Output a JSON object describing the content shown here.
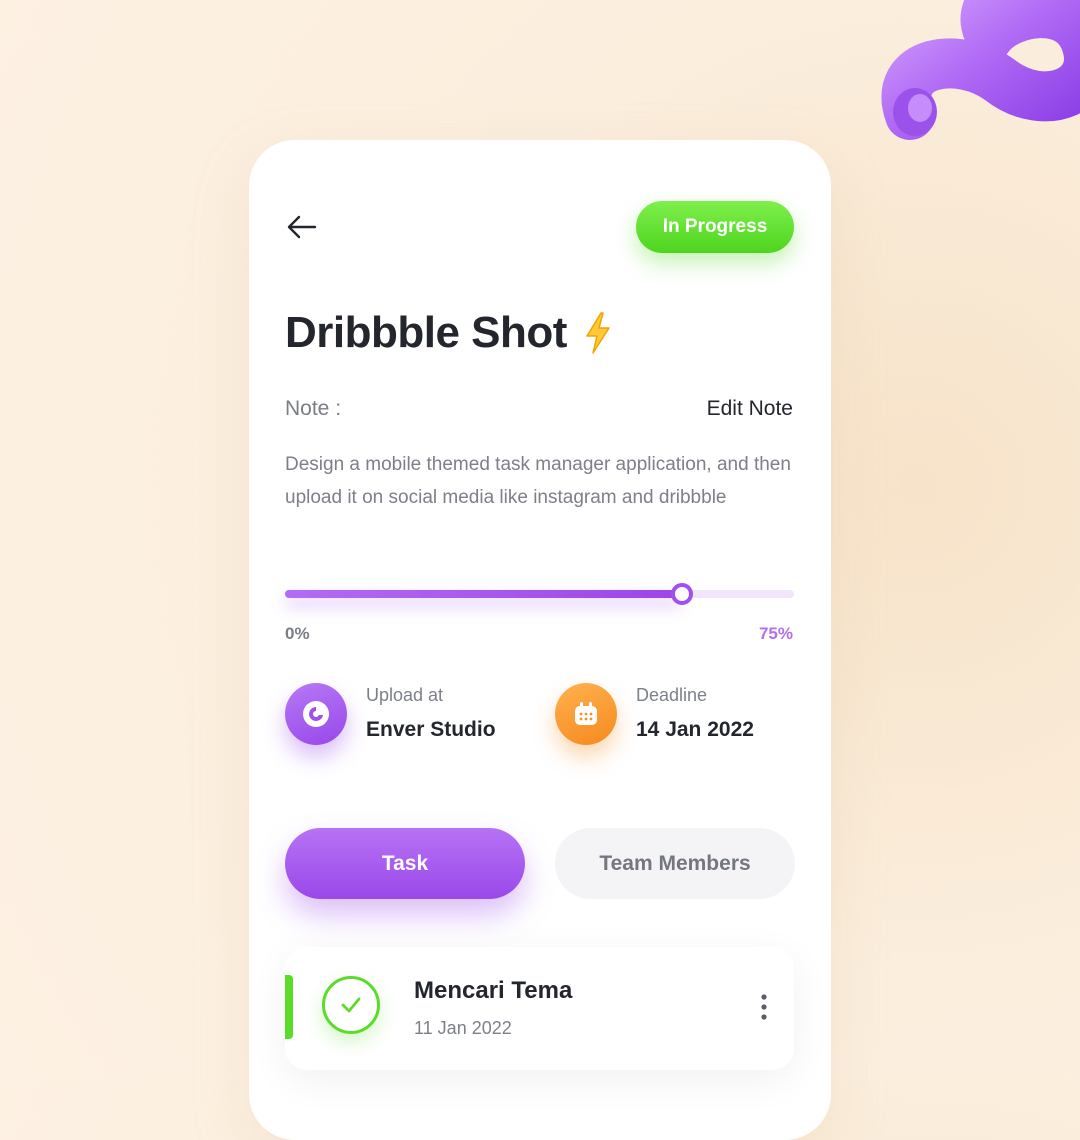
{
  "header": {
    "status_badge": "In Progress",
    "status_color": "#5cdc2a"
  },
  "project": {
    "title": "Dribbble Shot",
    "title_emoji_icon": "lightning-bolt-icon",
    "note_label": "Note :",
    "edit_note_label": "Edit Note",
    "description": "Design a mobile themed task manager application, and then upload it on social media like instagram and dribbble"
  },
  "progress": {
    "value": 0.78,
    "min_label": "0%",
    "max_label": "75%",
    "color": "#a24ff0"
  },
  "info": {
    "upload": {
      "label": "Upload at",
      "value": "Enver Studio",
      "icon": "studio-logo-icon",
      "color": "#9f50ef"
    },
    "deadline": {
      "label": "Deadline",
      "value": "14 Jan 2022",
      "icon": "calendar-icon",
      "color": "#f7921f"
    }
  },
  "tabs": [
    {
      "label": "Task",
      "active": true
    },
    {
      "label": "Team Members",
      "active": false
    }
  ],
  "tasks": [
    {
      "name": "Mencari Tema",
      "date": "11 Jan 2022",
      "done": true,
      "icon": "check-circle-icon"
    }
  ],
  "colors": {
    "accent": "#a24ff0",
    "success": "#5cdc2a",
    "warning": "#f7921f",
    "background": "#fdf1e3"
  }
}
